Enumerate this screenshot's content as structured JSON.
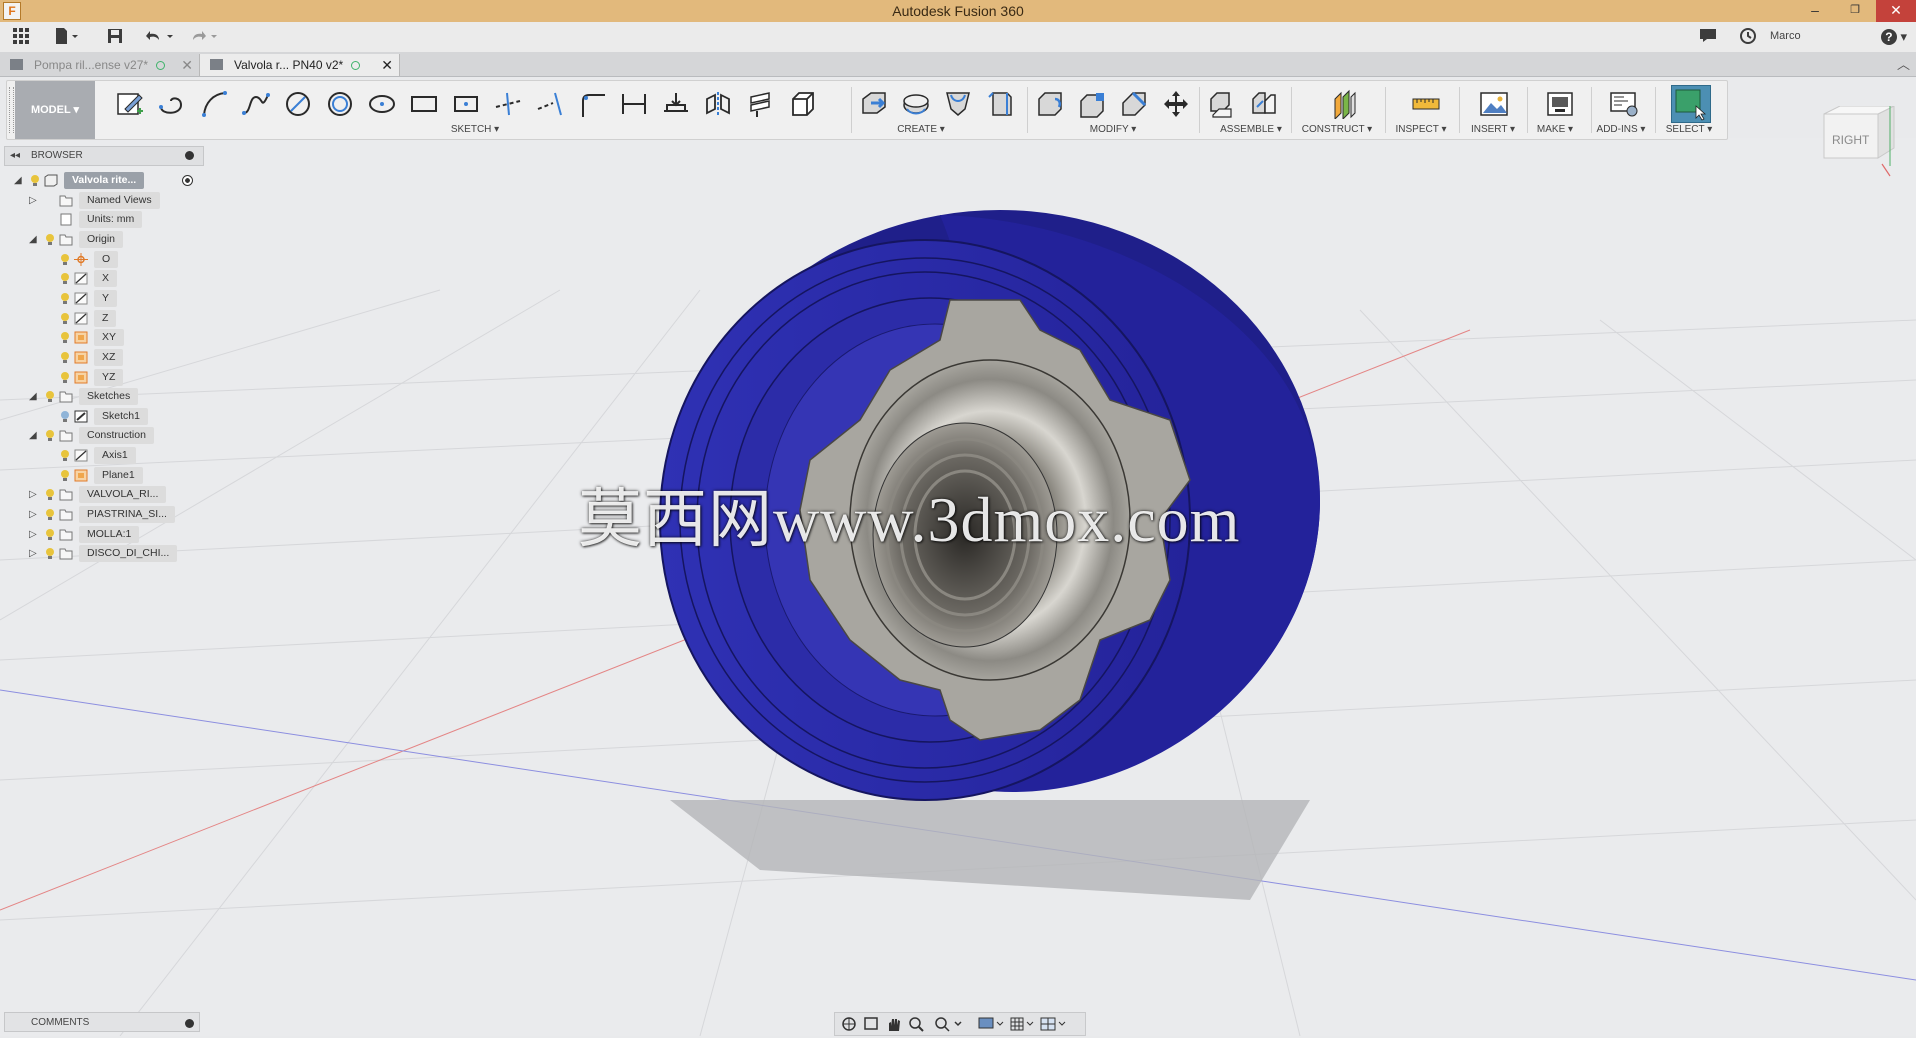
{
  "window": {
    "title": "Autodesk Fusion 360",
    "app_icon": "F",
    "minimize": "–",
    "restore": "❐",
    "close": "✕"
  },
  "quick_access": {
    "user": "Marco",
    "help": "?"
  },
  "tabs": [
    {
      "label": "Pompa ril...ense v27*",
      "close": "✕",
      "active": false
    },
    {
      "label": "Valvola r... PN40 v2*",
      "close": "✕",
      "active": true
    }
  ],
  "toolbar": {
    "model_label": "MODEL ▾",
    "groups": {
      "sketch": "SKETCH ▾",
      "create": "CREATE ▾",
      "modify": "MODIFY ▾",
      "assemble": "ASSEMBLE ▾",
      "construct": "CONSTRUCT ▾",
      "inspect": "INSPECT ▾",
      "insert": "INSERT ▾",
      "make": "MAKE ▾",
      "addins": "ADD-INS ▾",
      "select": "SELECT ▾"
    }
  },
  "browser": {
    "header": "BROWSER",
    "items": [
      {
        "label": "Valvola rite...",
        "level": 0,
        "expander": "◢",
        "type": "root"
      },
      {
        "label": "Named Views",
        "level": 1,
        "expander": "▷",
        "type": "folder"
      },
      {
        "label": "Units: mm",
        "level": 1,
        "expander": "",
        "type": "doc"
      },
      {
        "label": "Origin",
        "level": 1,
        "expander": "◢",
        "type": "folder"
      },
      {
        "label": "O",
        "level": 2,
        "expander": "",
        "type": "point"
      },
      {
        "label": "X",
        "level": 2,
        "expander": "",
        "type": "axis"
      },
      {
        "label": "Y",
        "level": 2,
        "expander": "",
        "type": "axis"
      },
      {
        "label": "Z",
        "level": 2,
        "expander": "",
        "type": "axis"
      },
      {
        "label": "XY",
        "level": 2,
        "expander": "",
        "type": "plane"
      },
      {
        "label": "XZ",
        "level": 2,
        "expander": "",
        "type": "plane"
      },
      {
        "label": "YZ",
        "level": 2,
        "expander": "",
        "type": "plane"
      },
      {
        "label": "Sketches",
        "level": 1,
        "expander": "◢",
        "type": "folder"
      },
      {
        "label": "Sketch1",
        "level": 2,
        "expander": "",
        "type": "sketch"
      },
      {
        "label": "Construction",
        "level": 1,
        "expander": "◢",
        "type": "folder"
      },
      {
        "label": "Axis1",
        "level": 2,
        "expander": "",
        "type": "axis"
      },
      {
        "label": "Plane1",
        "level": 2,
        "expander": "",
        "type": "plane"
      },
      {
        "label": "VALVOLA_RI...",
        "level": 1,
        "expander": "▷",
        "type": "component"
      },
      {
        "label": "PIASTRINA_SI...",
        "level": 1,
        "expander": "▷",
        "type": "component"
      },
      {
        "label": "MOLLA:1",
        "level": 1,
        "expander": "▷",
        "type": "component"
      },
      {
        "label": "DISCO_DI_CHI...",
        "level": 1,
        "expander": "▷",
        "type": "component"
      }
    ]
  },
  "comments": {
    "label": "COMMENTS"
  },
  "viewcube": {
    "face": "RIGHT"
  },
  "watermark": "莫西网www.3dmox.com",
  "colors": {
    "titlebar": "#e2b97c",
    "part_blue": "#2b2aa8",
    "metal": "#a9a7a0",
    "grid_bg": "#e9eaec"
  }
}
